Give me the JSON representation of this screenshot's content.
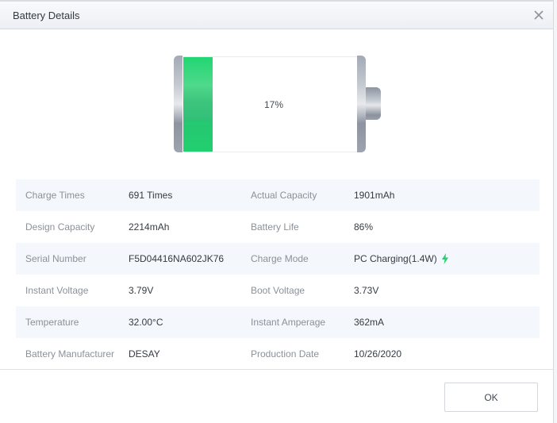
{
  "dialog": {
    "title": "Battery Details",
    "close_icon": "close-icon"
  },
  "battery": {
    "charge_percent": 17,
    "charge_label": "17%",
    "fill_color": "#22cf6f"
  },
  "details": {
    "rows": [
      {
        "label1": "Charge Times",
        "value1": "691 Times",
        "label2": "Actual Capacity",
        "value2": "1901mAh"
      },
      {
        "label1": "Design Capacity",
        "value1": "2214mAh",
        "label2": "Battery Life",
        "value2": "86%"
      },
      {
        "label1": "Serial Number",
        "value1": "F5D04416NA602JK76",
        "label2": "Charge Mode",
        "value2": "PC Charging(1.4W)"
      },
      {
        "label1": "Instant Voltage",
        "value1": "3.79V",
        "label2": "Boot Voltage",
        "value2": "3.73V"
      },
      {
        "label1": "Temperature",
        "value1": "32.00°C",
        "label2": "Instant Amperage",
        "value2": "362mA"
      },
      {
        "label1": "Battery Manufacturer",
        "value1": "DESAY",
        "label2": "Production Date",
        "value2": "10/26/2020"
      }
    ],
    "charge_mode_icon": "lightning-bolt-icon",
    "accent_color": "#2ecc71"
  },
  "footer": {
    "ok_label": "OK"
  }
}
